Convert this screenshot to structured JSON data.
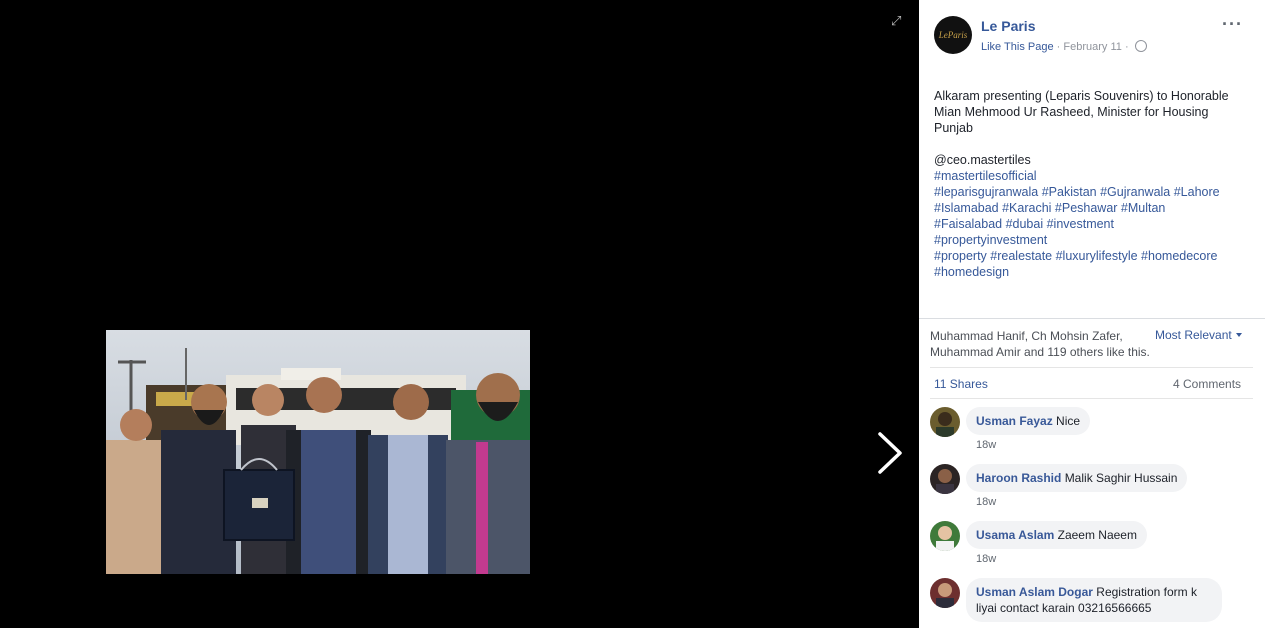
{
  "page": {
    "name": "Le Paris",
    "avatar_text": "LeParis",
    "like_link": "Like This Page",
    "separator": "·",
    "date": "February 11",
    "privacy": "·"
  },
  "post": {
    "text": "Alkaram presenting (Leparis Souvenirs) to Honorable Mian Mehmood Ur Rasheed, Minister for Housing Punjab",
    "mention": "@ceo.mastertiles",
    "hashtag_lines": [
      "#mastertilesofficial",
      "#leparisgujranwala #Pakistan #Gujranwala #Lahore",
      "#Islamabad #Karachi #Peshawar #Multan",
      "#Faisalabad #dubai #investment",
      "#propertyinvestment",
      "#property #realestate #luxurylifestyle #homedecore",
      "#homedesign"
    ]
  },
  "engagement": {
    "likes_text": "Muhammad Hanif, Ch Mohsin Zafer, Muhammad Amir and 119 others like this.",
    "sort_label": "Most Relevant",
    "shares": "11 Shares",
    "comments": "4 Comments"
  },
  "comments": [
    {
      "author": "Usman Fayaz",
      "text": "Nice",
      "time": "18w"
    },
    {
      "author": "Haroon Rashid",
      "text": "Malik Saghir Hussain",
      "time": "18w"
    },
    {
      "author": "Usama Aslam",
      "text": "Zaeem Naeem",
      "time": "18w"
    },
    {
      "author": "Usman Aslam Dogar",
      "text": "Registration form k liyai contact karain 03216566665",
      "time": ""
    }
  ],
  "icons": {
    "expand": "expand-icon",
    "next": "chevron-right-icon",
    "more": "more-options-icon",
    "privacy": "globe-icon"
  },
  "colors": {
    "link": "#365899",
    "viewer_bg": "#000000",
    "bubble_bg": "#f2f3f5"
  }
}
